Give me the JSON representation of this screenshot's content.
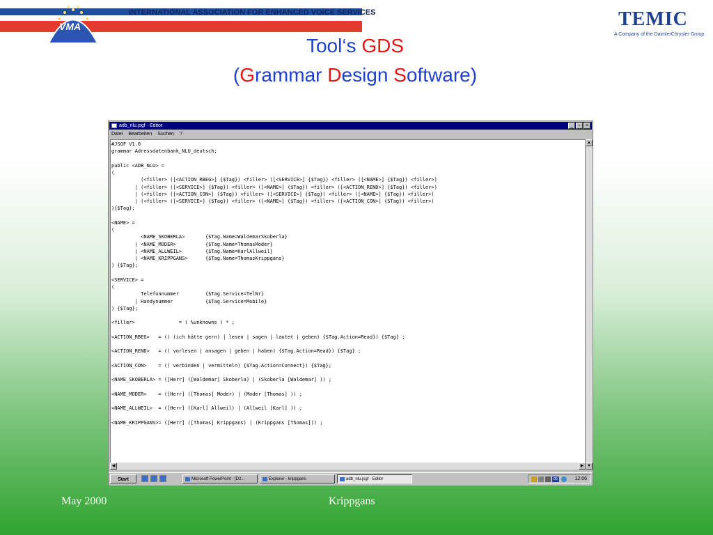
{
  "header": {
    "association": "INTERNATIONAL ASSOCIATION FOR ENHANCED VOICE SERVICES",
    "logo_text": "VMA",
    "company": "TEMIC",
    "company_sub": "A Company of the DaimlerChrysler Group"
  },
  "slide": {
    "title_a": "Tool‘s ",
    "title_b": "GDS",
    "sub_open": "(",
    "sub_g": "G",
    "sub_rammar": "rammar ",
    "sub_d": "D",
    "sub_esign": "esign ",
    "sub_s": "S",
    "sub_oftware": "oftware",
    "sub_close": ")"
  },
  "window": {
    "title": "adb_nlu.jsgf - Editor",
    "menu": [
      "Datei",
      "Bearbeiten",
      "Suchen",
      "?"
    ],
    "controls": [
      "_",
      "▫",
      "×"
    ]
  },
  "editor": {
    "content": "#JSGF V1.0\ngrammar Adressdatenbank_NLU_deutsch;\n\npublic <ADB_NLU> =\n(\n          (<filler> ([<ACTION_RBEG>] {$Tag}) <filler> ([<SERVICE>] {$Tag}) <filler> ([<NAME>] {$Tag}) <filler>)\n        | (<filler> ([<SERVICE>] {$Tag}) <filler> ([<NAME>] {$Tag}) <filler> ([<ACTION_REND>] {$Tag}) <filler>)\n        | (<filler> ([<ACTION_CON>] {$Tag}) <filler> ([<SERVICE>] {$Tag}) <filler> ([<NAME>] {$Tag}) <filler>)\n        | (<filler> ([<SERVICE>] {$Tag}) <filler> ([<NAME>] {$Tag}) <filler> ([<ACTION_CON>] {$Tag}) <filler>)\n){$Tag};\n\n<NAME> =\n(\n          <NAME_SKOBERLA>       {$Tag.Name=WaldemarSkoberla}\n        | <NAME_MODER>          {$Tag.Name=ThomasModer}\n        | <NAME_ALLWEIL>        {$Tag.Name=KarlAllweil}\n        | <NAME_KRIPPGANS>      {$Tag.Name=ThomasKrippgans}\n) {$Tag};\n\n<SERVICE> =\n(\n          Telefonnummer         {$Tag.Service=TelNr}\n        | Handynummer           {$Tag.Service=Mobile}\n) {$Tag};\n\n<filler>               = ( %unknowns ) * ;\n\n<ACTION_RBEG>   = (( (ich hätte gern) | lesen | sagen | lautet | geben) {$Tag.Action=Read}) {$Tag} ;\n\n<ACTION_REND>   = (( vorlesen | ansagen | geben | haben) {$Tag.Action=Read}) {$Tag} ;\n\n<ACTION_CON>    = (( verbinden | vermitteln) {$Tag.Action=Connect}) {$Tag};\n\n<NAME_SKOBERLA> = ([Herr] ([Waldemar] Skoberla) | (Skoberla [Waldemar] )) ;\n\n<NAME_MODER>    = ([Herr] ([Thomas] Moder) | (Moder [Thomas] )) ;\n\n<NAME_ALLWEIL>  = ([Herr] ([Karl] Allweil) | (Allweil [Karl] )) ;\n\n<NAME_KRIPPGANS>= ([Herr] ([Thomas] Krippgans) | (Krippgans [Thomas])) ;"
  },
  "taskbar": {
    "start": "Start",
    "tasks": [
      "Microsoft PowerPoint - [D2...",
      "Explorer - krippgans",
      "adb_nlu.jsgf - Editor"
    ],
    "lang": "DE",
    "clock": "12:06"
  },
  "footer": {
    "date": "May 2000",
    "author": "Krippgans"
  },
  "colors": {
    "title_blue": "#1f3fd0",
    "title_red": "#e01818",
    "titlebar": "#00007b"
  }
}
